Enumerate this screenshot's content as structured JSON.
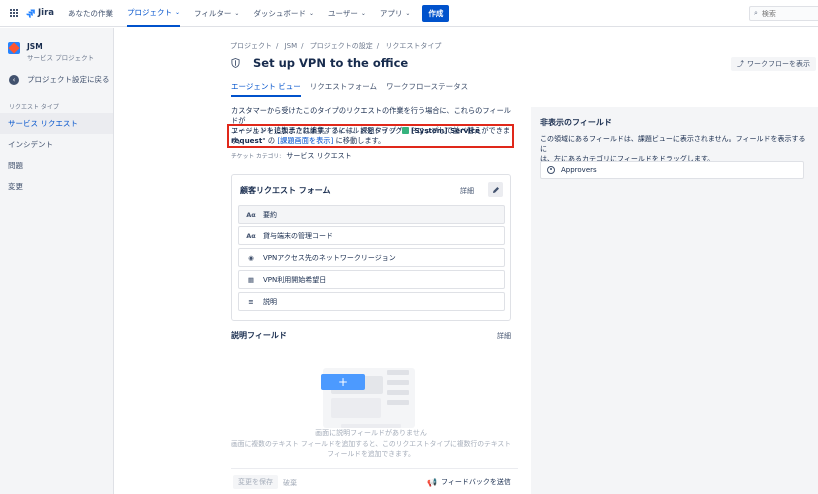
{
  "topnav": {
    "logo": "Jira",
    "items": [
      {
        "label": "あなたの作業",
        "dropdown": false,
        "active": false
      },
      {
        "label": "プロジェクト",
        "dropdown": true,
        "active": true
      },
      {
        "label": "フィルター",
        "dropdown": true,
        "active": false
      },
      {
        "label": "ダッシュボード",
        "dropdown": true,
        "active": false
      },
      {
        "label": "ユーザー",
        "dropdown": true,
        "active": false
      },
      {
        "label": "アプリ",
        "dropdown": true,
        "active": false
      }
    ],
    "create_label": "作成",
    "search_placeholder": "検索"
  },
  "sidebar": {
    "project_name": "JSM",
    "project_type": "サービス プロジェクト",
    "back_label": "プロジェクト設定に戻る",
    "section_label": "リクエスト タイプ",
    "items": [
      {
        "label": "サービス リクエスト",
        "active": true
      },
      {
        "label": "インシデント",
        "active": false
      },
      {
        "label": "問題",
        "active": false
      },
      {
        "label": "変更",
        "active": false
      }
    ]
  },
  "breadcrumb": [
    "プロジェクト",
    "JSM",
    "プロジェクトの設定",
    "リクエストタイプ"
  ],
  "page_title": "Set up VPN to the office",
  "workflow_button": "ワークフローを表示",
  "tabs": [
    {
      "label": "エージェント ビュー",
      "active": true
    },
    {
      "label": "リクエストフォーム",
      "active": false
    },
    {
      "label": "ワークフローステータス",
      "active": false
    }
  ],
  "description": {
    "line1": "カスタマーから受けたこのタイプのリクエストの作業を行う場合に、これらのフィールドが",
    "line2": "エージェントに表示されます。フィールドをドラッグ＆ドロップして並べ替えができます。",
    "highlight_pre": "フィールドを追加または編集するには、課題タイプ \"",
    "issue_type": "[System] Service request",
    "highlight_mid": "\" の",
    "link": "[課題画面を表示]",
    "highlight_post": "に移動します。"
  },
  "ticket_category": {
    "label": "チケット カテゴリ:",
    "value": "サービス リクエスト"
  },
  "form_card": {
    "title": "顧客リクエスト フォーム",
    "detail": "詳細",
    "fields": [
      {
        "icon": "Aα",
        "label": "要約",
        "grey": true
      },
      {
        "icon": "Aα",
        "label": "貸与端末の管理コード",
        "grey": false
      },
      {
        "icon": "◉",
        "label": "VPNアクセス先のネットワークリージョン",
        "grey": false
      },
      {
        "icon": "▦",
        "label": "VPN利用開始希望日",
        "grey": false
      },
      {
        "icon": "≡",
        "label": "説明",
        "grey": false
      }
    ]
  },
  "description_fields": {
    "title": "説明フィールド",
    "detail": "詳細",
    "empty_title": "画面に説明フィールドがありません",
    "empty_line1": "画面に複数のテキスト フィールドを追加すると、このリクエストタイプに複数行のテキスト",
    "empty_line2": "フィールドを追加できます。"
  },
  "footer": {
    "save": "変更を保存",
    "discard": "破棄",
    "feedback": "フィードバックを送信"
  },
  "hidden_fields": {
    "title": "非表示のフィールド",
    "desc_line1": "この領域にあるフィールドは、課題ビューに表示されません。フィールドを表示するに",
    "desc_line2": "は、左にあるカテゴリにフィールドをドラッグします。",
    "items": [
      "Approvers"
    ]
  },
  "colors": {
    "accent": "#0052cc",
    "highlight_border": "#e0281a",
    "issue_type_icon": "#36b37e"
  }
}
